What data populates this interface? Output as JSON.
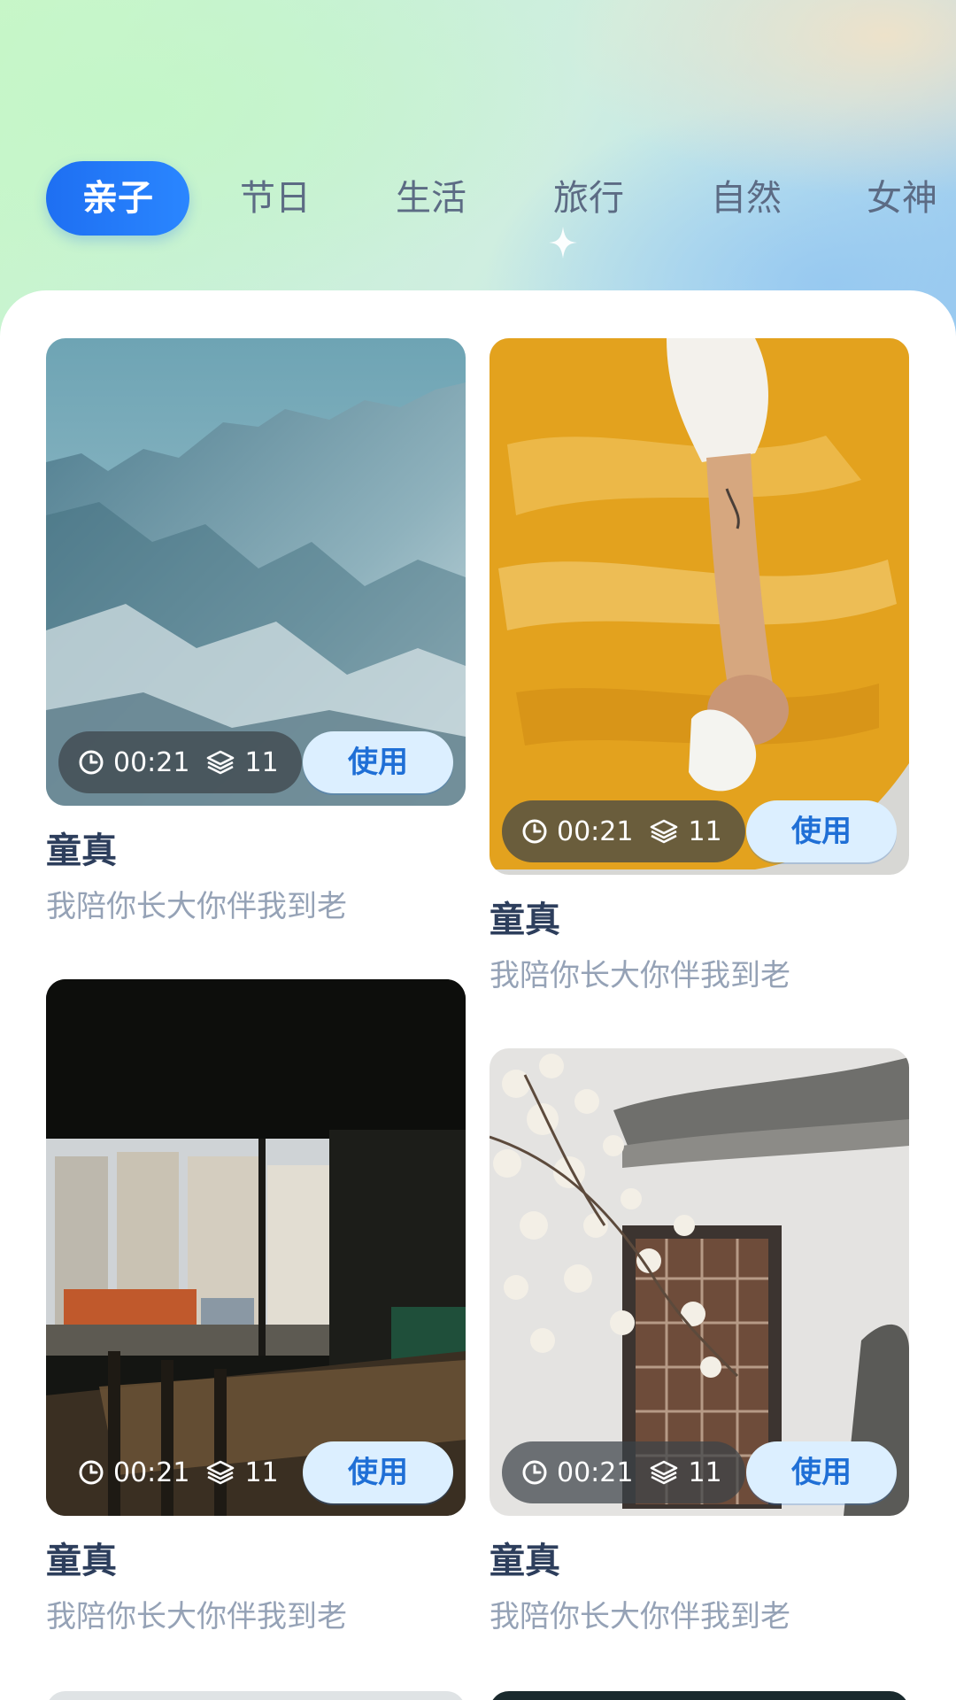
{
  "tabs": [
    {
      "label": "亲子",
      "active": true
    },
    {
      "label": "节日",
      "active": false
    },
    {
      "label": "生活",
      "active": false
    },
    {
      "label": "旅行",
      "active": false
    },
    {
      "label": "自然",
      "active": false
    },
    {
      "label": "女神",
      "active": false
    }
  ],
  "cards": [
    {
      "title": "童真",
      "subtitle": "我陪你长大你伴我到老",
      "duration": "00:21",
      "count": "11",
      "button": "使用",
      "scene": "snowy mountains"
    },
    {
      "title": "童真",
      "subtitle": "我陪你长大你伴我到老",
      "duration": "00:21",
      "count": "11",
      "button": "使用",
      "scene": "hand painting yellow"
    },
    {
      "title": "童真",
      "subtitle": "我陪你长大你伴我到老",
      "duration": "00:21",
      "count": "11",
      "button": "使用",
      "scene": "dark room window"
    },
    {
      "title": "童真",
      "subtitle": "我陪你长大你伴我到老",
      "duration": "00:21",
      "count": "11",
      "button": "使用",
      "scene": "magnolia and chinese door"
    }
  ],
  "colors": {
    "accent": "#2a7cff",
    "title": "#2d3e5c",
    "subtitle": "#95a2b6",
    "button_bg": "#dcefff",
    "button_text": "#1f6fd6"
  },
  "icons": {
    "duration": "clock-icon",
    "count": "layers-icon",
    "decoration": "sparkle-icon"
  }
}
